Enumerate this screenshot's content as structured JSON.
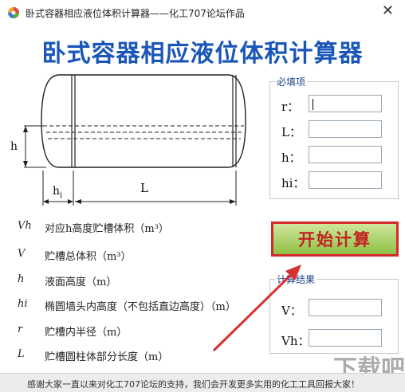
{
  "window": {
    "title": "卧式容器相应液位体积计算器——化工707论坛作品",
    "close_glyph": "✕"
  },
  "heading": "卧式容器相应液位体积计算器",
  "diagram": {
    "label_h": "h",
    "label_hi": "h",
    "label_hi_sub": "i",
    "label_L": "L"
  },
  "descriptions": [
    {
      "sym": "Vh",
      "text": "对应h高度贮槽体积（m³）"
    },
    {
      "sym": "V",
      "text": "贮槽总体积（m³）"
    },
    {
      "sym": "h",
      "text": "液面高度（m）"
    },
    {
      "sym": "hi",
      "text": "椭圆墙头内高度（不包括直边高度）（m）"
    },
    {
      "sym": "r",
      "text": "贮槽内半径（m）"
    },
    {
      "sym": "L",
      "text": "贮槽圆柱体部分长度（m）"
    }
  ],
  "required_group": {
    "title": "必填项",
    "fields": [
      {
        "label": "r：",
        "value": ""
      },
      {
        "label": "L：",
        "value": ""
      },
      {
        "label": "h：",
        "value": ""
      },
      {
        "label": "hi：",
        "value": ""
      }
    ]
  },
  "start_button": "开始计算",
  "result_group": {
    "title": "计算结果",
    "fields": [
      {
        "label": "V：",
        "value": ""
      },
      {
        "label": "Vh：",
        "value": ""
      }
    ]
  },
  "footer": "感谢大家一直以来对化工707论坛的支持，我们会开发更多实用的化工工具回报大家！",
  "watermark": "下载吧",
  "colors": {
    "heading": "#1a56b8",
    "button_text": "#c42222",
    "button_border": "#d42a2a",
    "arrow": "#d83030"
  }
}
